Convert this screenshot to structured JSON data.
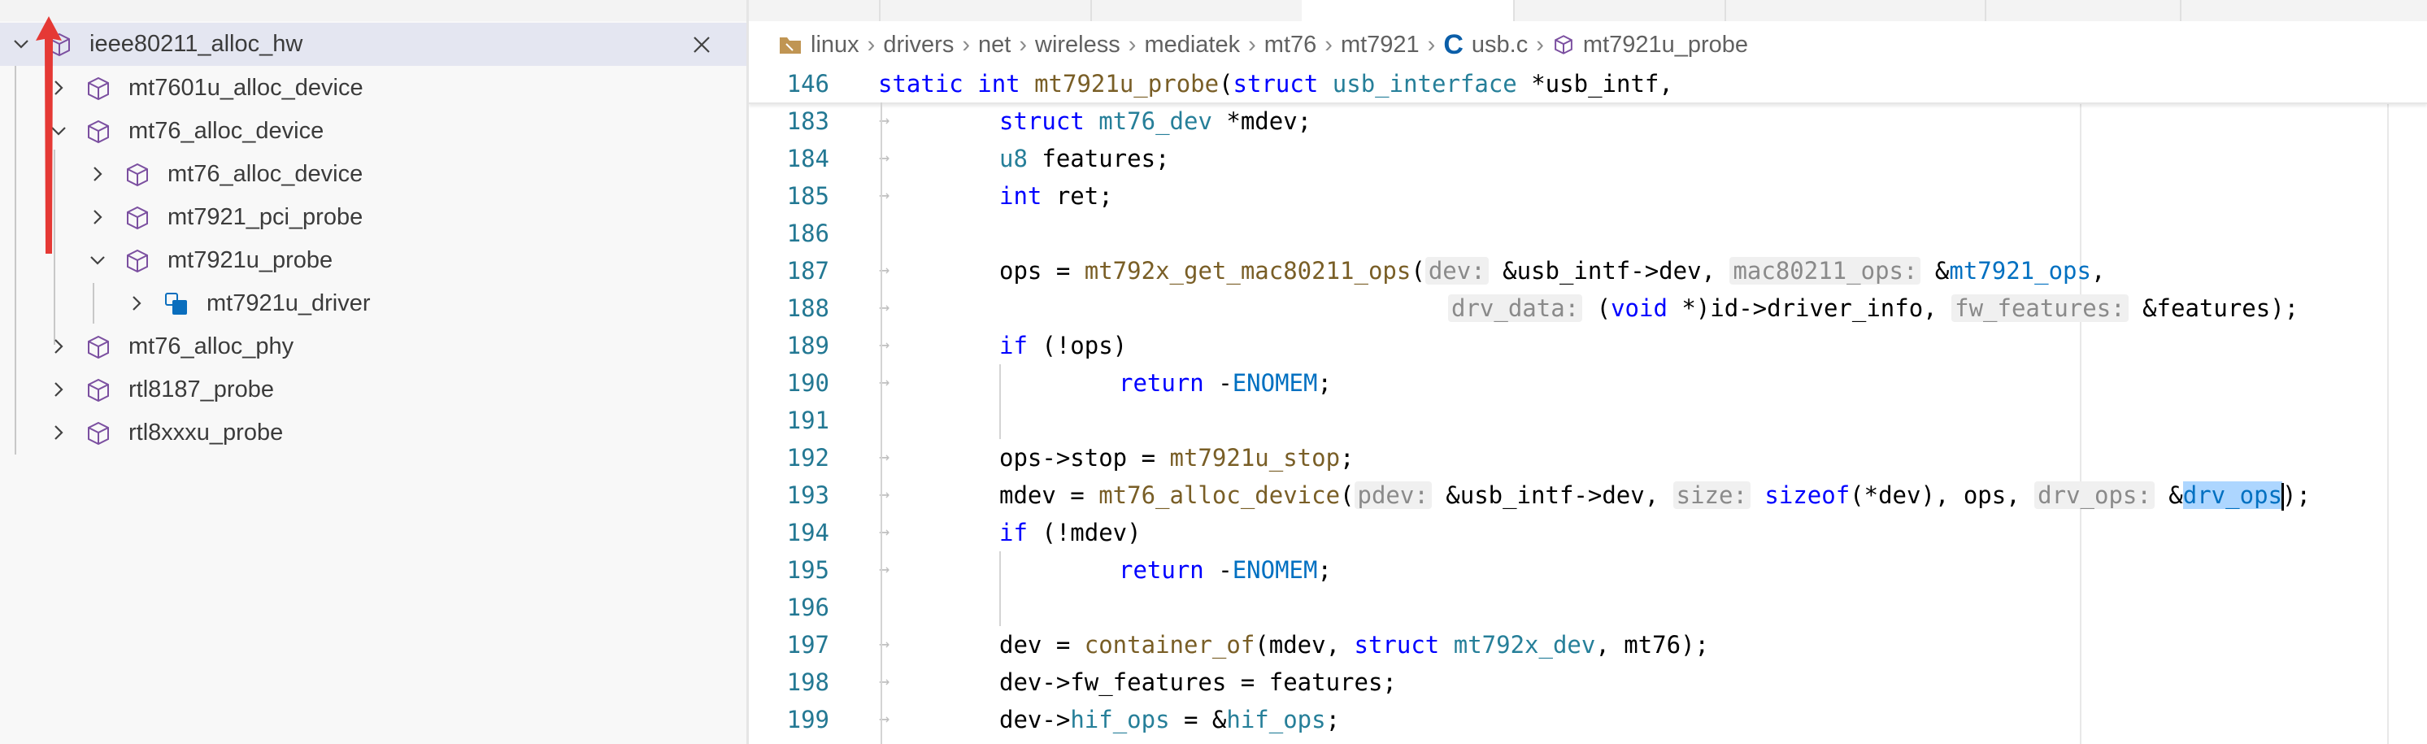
{
  "call_hierarchy": {
    "root": "ieee80211_alloc_hw",
    "items": [
      {
        "label": "mt7601u_alloc_device"
      },
      {
        "label": "mt76_alloc_device"
      },
      {
        "label": "mt76_alloc_device"
      },
      {
        "label": "mt7921_pci_probe"
      },
      {
        "label": "mt7921u_probe"
      },
      {
        "label": "mt7921u_driver"
      },
      {
        "label": "mt76_alloc_phy"
      },
      {
        "label": "rtl8187_probe"
      },
      {
        "label": "rtl8xxxu_probe"
      }
    ]
  },
  "breadcrumb": [
    "linux",
    "drivers",
    "net",
    "wireless",
    "mediatek",
    "mt76",
    "mt7921",
    "usb.c",
    "mt7921u_probe"
  ],
  "code": {
    "sticky_line_number": "146",
    "line_numbers": [
      "183",
      "184",
      "185",
      "186",
      "187",
      "188",
      "189",
      "190",
      "191",
      "192",
      "193",
      "194",
      "195",
      "196",
      "197",
      "198",
      "199"
    ],
    "hints": {
      "dev": "dev:",
      "mac80211_ops": "mac80211_ops:",
      "drv_data": "drv_data:",
      "fw_features": "fw_features:",
      "pdev": "pdev:",
      "size": "size:",
      "drv_ops": "drv_ops:"
    }
  },
  "colors": {
    "keyword": "#0000ff",
    "function": "#795e26",
    "type": "#267f99",
    "line_number": "#237893",
    "selection": "#add6ff",
    "arrow": "#e53935"
  }
}
